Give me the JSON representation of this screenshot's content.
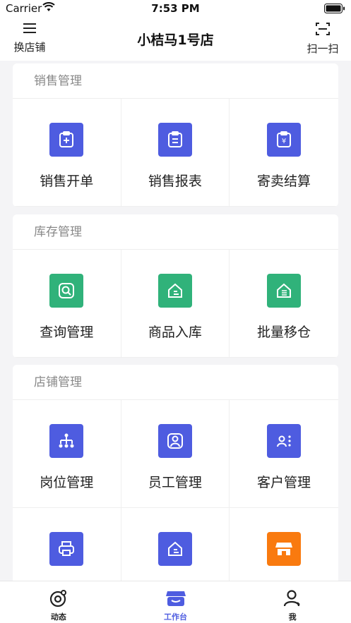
{
  "status_bar": {
    "carrier": "Carrier",
    "time": "7:53 PM"
  },
  "nav": {
    "left_label": "换店铺",
    "title": "小桔马1号店",
    "right_label": "扫一扫"
  },
  "sections": [
    {
      "title": "销售管理",
      "items": [
        {
          "label": "销售开单",
          "icon": "clipboard-plus-icon",
          "color": "#4e5ce0"
        },
        {
          "label": "销售报表",
          "icon": "clipboard-list-icon",
          "color": "#4e5ce0"
        },
        {
          "label": "寄卖结算",
          "icon": "clipboard-yen-icon",
          "color": "#4e5ce0"
        }
      ]
    },
    {
      "title": "库存管理",
      "items": [
        {
          "label": "查询管理",
          "icon": "search-icon",
          "color": "#30b27a"
        },
        {
          "label": "商品入库",
          "icon": "house-in-icon",
          "color": "#30b27a"
        },
        {
          "label": "批量移仓",
          "icon": "house-transfer-icon",
          "color": "#30b27a"
        }
      ]
    },
    {
      "title": "店铺管理",
      "items": [
        {
          "label": "岗位管理",
          "icon": "org-chart-icon",
          "color": "#4e5ce0"
        },
        {
          "label": "员工管理",
          "icon": "employee-icon",
          "color": "#4e5ce0"
        },
        {
          "label": "客户管理",
          "icon": "customer-icon",
          "color": "#4e5ce0"
        },
        {
          "label": "",
          "icon": "printer-icon",
          "color": "#4e5ce0"
        },
        {
          "label": "",
          "icon": "warehouse-icon",
          "color": "#4e5ce0"
        },
        {
          "label": "",
          "icon": "store-icon",
          "color": "#f97a0f"
        }
      ]
    }
  ],
  "tabs": [
    {
      "label": "动态",
      "icon": "activity-icon",
      "active": false
    },
    {
      "label": "工作台",
      "icon": "workbench-icon",
      "active": true
    },
    {
      "label": "我",
      "icon": "profile-icon",
      "active": false
    }
  ],
  "colors": {
    "accent": "#4e5ce0",
    "green": "#30b27a",
    "orange": "#f97a0f"
  }
}
